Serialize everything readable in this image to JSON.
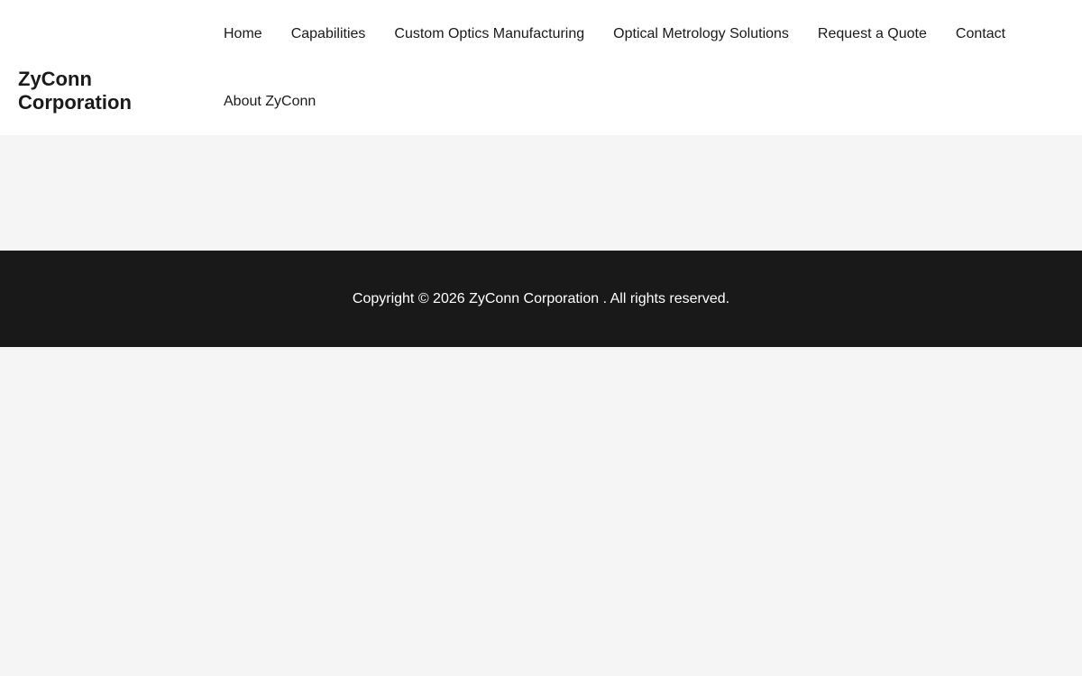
{
  "site": {
    "title": "ZyConn Corporation"
  },
  "nav": {
    "row1": [
      {
        "label": "Home"
      },
      {
        "label": "Capabilities"
      },
      {
        "label": "Custom Optics Manufacturing"
      },
      {
        "label": "Optical Metrology Solutions"
      },
      {
        "label": "Request a Quote"
      },
      {
        "label": "Contact"
      }
    ],
    "row2": [
      {
        "label": "About ZyConn"
      }
    ]
  },
  "footer": {
    "copyright": "Copyright © 2026 ZyConn Corporation . All rights reserved."
  },
  "colors": {
    "header_bg": "#ffffff",
    "page_bg": "#f5f5f5",
    "footer_bg": "#191919",
    "text": "#1a1a1a",
    "footer_text": "#ffffff"
  }
}
